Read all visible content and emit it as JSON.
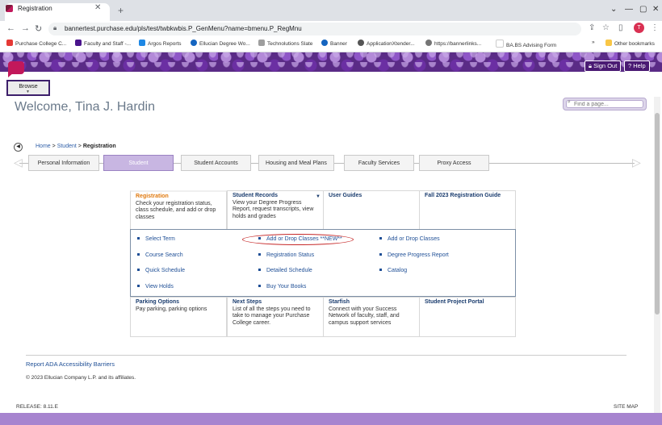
{
  "browser": {
    "tab_title": "Registration",
    "url": "bannertest.purchase.edu/pls/test/twbkwbis.P_GenMenu?name=bmenu.P_RegMnu",
    "profile_initial": "T",
    "bookmarks": [
      {
        "label": "Purchase College C...",
        "color": "#e53935"
      },
      {
        "label": "Faculty and Staff -...",
        "color": "#4a148c"
      },
      {
        "label": "Argos Reports",
        "color": "#1e88e5"
      },
      {
        "label": "Ellucian Degree Wo...",
        "color": "#1565c0"
      },
      {
        "label": "Technolutions Slate",
        "color": "#9e9e9e"
      },
      {
        "label": "Banner",
        "color": "#1565c0"
      },
      {
        "label": "ApplicationXtender...",
        "color": "#555555"
      },
      {
        "label": "https://bannerlinks...",
        "color": "#757575"
      },
      {
        "label": "BA.BS Advising Form",
        "color": "#ffffff"
      }
    ],
    "other_bookmarks": "Other bookmarks"
  },
  "header": {
    "sign_out": "Sign Out",
    "help": "Help",
    "browse": "Browse",
    "welcome": "Welcome, Tina J. Hardin",
    "find_placeholder": "Find a page..."
  },
  "breadcrumb": {
    "home": "Home",
    "sep": ">",
    "student": "Student",
    "current": "Registration"
  },
  "nav_tabs": [
    "Personal Information",
    "Student",
    "Student Accounts",
    "Housing and Meal Plans",
    "Faculty Services",
    "Proxy Access"
  ],
  "top_cells": [
    {
      "title": "Registration",
      "desc": "Check your registration status, class schedule, and add or drop classes"
    },
    {
      "title": "Student Records",
      "desc": "View your Degree Progress Report, request transcripts, view holds and grades"
    },
    {
      "title": "User Guides",
      "desc": ""
    },
    {
      "title": "Fall 2023 Registration Guide",
      "desc": ""
    }
  ],
  "menu_links": {
    "col1": [
      "Select Term",
      "Course Search",
      "Quick Schedule",
      "View Holds"
    ],
    "col2": [
      "Add or Drop Classes **NEW**",
      "Registration Status",
      "Detailed Schedule",
      "Buy Your Books"
    ],
    "col3": [
      "Add or Drop Classes",
      "Degree Progress Report",
      "Catalog"
    ]
  },
  "bottom_cells": [
    {
      "title": "Parking Options",
      "desc": "Pay parking, parking options"
    },
    {
      "title": "Next Steps",
      "desc": "List of all the steps you need to take to manage your Purchase College career."
    },
    {
      "title": "Starfish",
      "desc": "Connect with your Success Network of faculty, staff, and campus support services"
    },
    {
      "title": "Student Project Portal",
      "desc": ""
    }
  ],
  "footer": {
    "ada": "Report ADA Accessibility Barriers",
    "copyright": "© 2023 Ellucian Company L.P. and its affiliates.",
    "release": "RELEASE: 8.11.E",
    "sitemap": "SITE MAP"
  }
}
